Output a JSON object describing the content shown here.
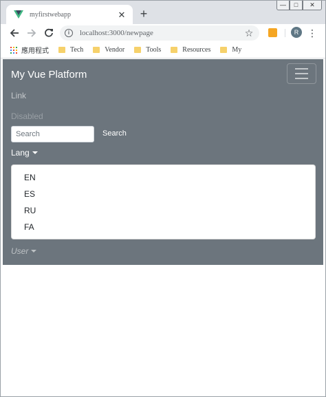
{
  "browser": {
    "tab_title": "myfirstwebapp",
    "tab_close": "✕",
    "new_tab": "+",
    "url": "localhost:3000/newpage",
    "window_controls": {
      "minimize": "—",
      "maximize": "□",
      "close": "✕"
    },
    "profile_initial": "R"
  },
  "bookmarks": {
    "apps_label": "應用程式",
    "items": [
      {
        "label": "Tech"
      },
      {
        "label": "Vendor"
      },
      {
        "label": "Tools"
      },
      {
        "label": "Resources"
      },
      {
        "label": "My"
      }
    ]
  },
  "navbar": {
    "brand": "My Vue Platform",
    "links": {
      "link": "Link",
      "disabled": "Disabled"
    },
    "search": {
      "placeholder": "Search",
      "button": "Search"
    },
    "lang": {
      "label": "Lang",
      "options": [
        "EN",
        "ES",
        "RU",
        "FA"
      ]
    },
    "user": {
      "label": "User"
    },
    "background_color": "#6c757d"
  }
}
